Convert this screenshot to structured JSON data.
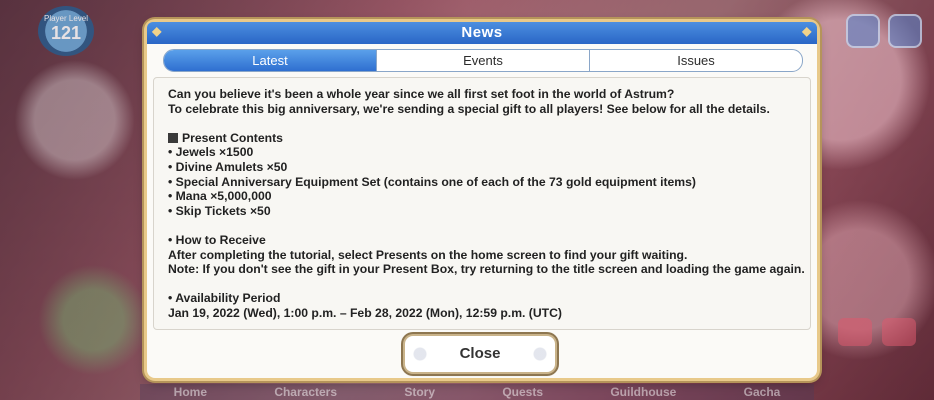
{
  "background": {
    "level": {
      "label": "Player Level",
      "value": "121"
    },
    "bottom_nav": [
      "Home",
      "Characters",
      "Story",
      "Quests",
      "Guildhouse",
      "Gacha"
    ]
  },
  "dialog": {
    "title": "News",
    "tabs": [
      {
        "label": "Latest",
        "active": true
      },
      {
        "label": "Events",
        "active": false
      },
      {
        "label": "Issues",
        "active": false
      }
    ],
    "intro_1": "Can you believe it's been a whole year since we all first set foot in the world of Astrum?",
    "intro_2": "To celebrate this big anniversary, we're sending a special gift to all players! See below for all the details.",
    "present_heading": "Present Contents",
    "presents": [
      "• Jewels ×1500",
      "• Divine Amulets ×50",
      "• Special Anniversary Equipment Set (contains one of each of the 73 gold equipment items)",
      "• Mana ×5,000,000",
      "• Skip Tickets ×50"
    ],
    "receive_heading": "• How to Receive",
    "receive_1": "After completing the tutorial, select Presents on the home screen to find your gift waiting.",
    "receive_2": "Note: If you don't see the gift in your Present Box, try returning to the title screen and loading the game again.",
    "period_heading": "• Availability Period",
    "period": "Jan 19, 2022 (Wed), 1:00 p.m. – Feb 28, 2022 (Mon), 12:59 p.m. (UTC)",
    "close_label": "Close"
  },
  "colors": {
    "header": "#2a66c6",
    "tab_active": "#3f80dc",
    "border_gold": "#b5945a"
  }
}
